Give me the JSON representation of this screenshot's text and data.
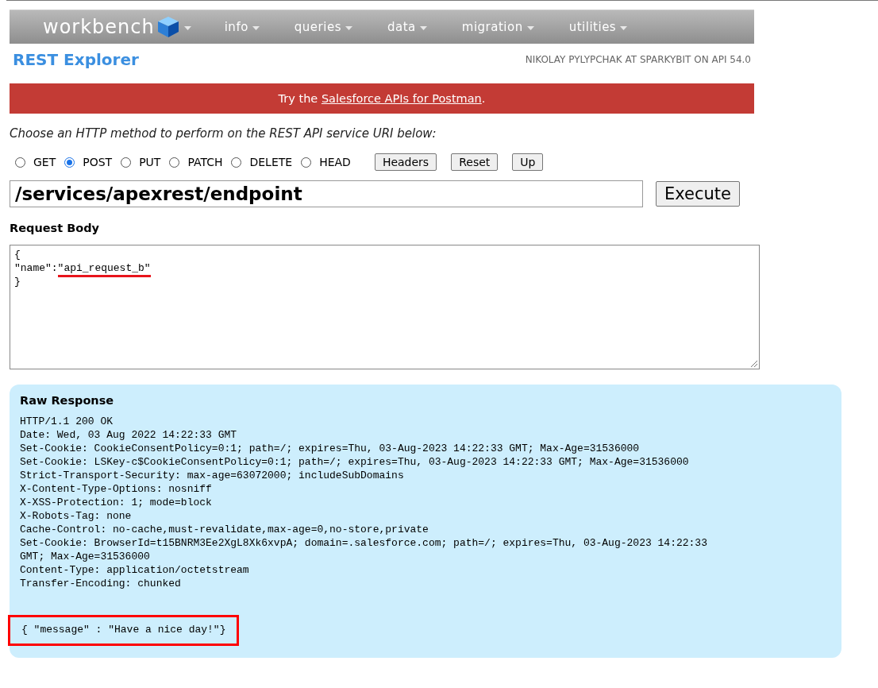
{
  "nav": {
    "logo": "workbench",
    "menus": [
      {
        "label": "info"
      },
      {
        "label": "queries"
      },
      {
        "label": "data"
      },
      {
        "label": "migration"
      },
      {
        "label": "utilities"
      }
    ]
  },
  "page_title": "REST Explorer",
  "user_info": "NIKOLAY PYLYPCHAK AT SPARKYBIT ON API 54.0",
  "banner": {
    "before": "Try the ",
    "link": "Salesforce APIs for Postman",
    "after": "."
  },
  "prompt": "Choose an HTTP method to perform on the REST API service URI below:",
  "methods": [
    {
      "label": "GET",
      "selected": false
    },
    {
      "label": "POST",
      "selected": true
    },
    {
      "label": "PUT",
      "selected": false
    },
    {
      "label": "PATCH",
      "selected": false
    },
    {
      "label": "DELETE",
      "selected": false
    },
    {
      "label": "HEAD",
      "selected": false
    }
  ],
  "buttons": [
    "Headers",
    "Reset",
    "Up"
  ],
  "uri": {
    "value": "/services/apexrest/endpoint"
  },
  "execute": "Execute",
  "request_body": {
    "label": "Request Body",
    "lines": [
      [
        {
          "text": "{",
          "underlined": false
        }
      ],
      [
        {
          "text": "\"name\":",
          "underlined": false
        },
        {
          "text": "\"api_request_b\"",
          "underlined": true
        }
      ],
      [
        {
          "text": "}",
          "underlined": false
        }
      ]
    ]
  },
  "response": {
    "title": "Raw Response",
    "headers": [
      "HTTP/1.1 200 OK",
      "Date: Wed, 03 Aug 2022 14:22:33 GMT",
      "Set-Cookie: CookieConsentPolicy=0:1; path=/; expires=Thu, 03-Aug-2023 14:22:33 GMT; Max-Age=31536000",
      "Set-Cookie: LSKey-c$CookieConsentPolicy=0:1; path=/; expires=Thu, 03-Aug-2023 14:22:33 GMT; Max-Age=31536000",
      "Strict-Transport-Security: max-age=63072000; includeSubDomains",
      "X-Content-Type-Options: nosniff",
      "X-XSS-Protection: 1; mode=block",
      "X-Robots-Tag: none",
      "Cache-Control: no-cache,must-revalidate,max-age=0,no-store,private",
      "Set-Cookie: BrowserId=t15BNRM3Ee2XgL8Xk6xvpA; domain=.salesforce.com; path=/; expires=Thu, 03-Aug-2023 14:22:33",
      "GMT; Max-Age=31536000",
      "Content-Type: application/octetstream",
      "Transfer-Encoding: chunked"
    ],
    "body": {
      "text": "{ \"message\" : \"Have a nice day!\"}",
      "boxed": true
    }
  }
}
